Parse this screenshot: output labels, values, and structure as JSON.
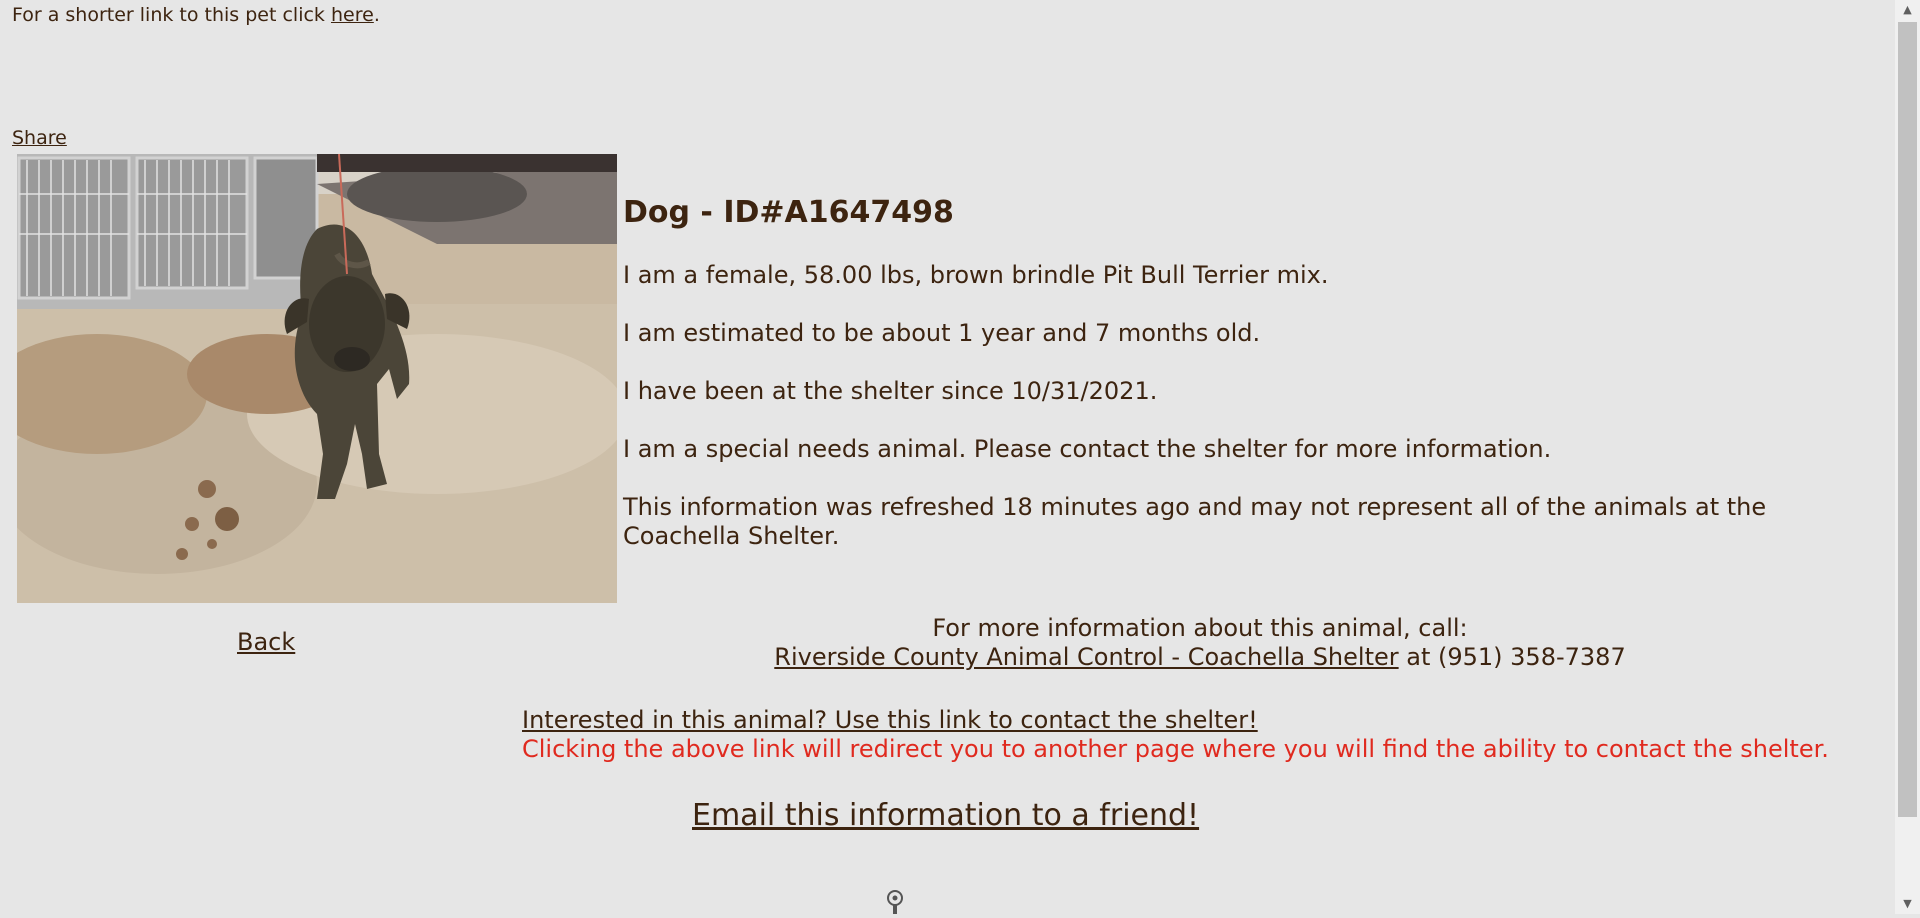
{
  "top": {
    "prefix": "For a shorter link to this pet click ",
    "link": "here",
    "suffix": "."
  },
  "share_label": "Share",
  "animal": {
    "heading": "Dog - ID#A1647498",
    "description": "I am a female, 58.00 lbs, brown brindle Pit Bull Terrier mix.",
    "age": "I am estimated to be about 1 year and 7 months old.",
    "since": "I have been at the shelter since 10/31/2021.",
    "special_needs": "I am a special needs animal. Please contact the shelter for more information.",
    "refresh": "This information was refreshed 18 minutes ago and may not represent all of the animals at the Coachella Shelter."
  },
  "back_label": "Back",
  "contact": {
    "intro": "For more information about this animal, call:",
    "shelter_link": "Riverside County Animal Control - Coachella Shelter",
    "phone_text": " at (951) 358-7387"
  },
  "interest": {
    "link": "Interested in this animal? Use this link to contact the shelter!",
    "note": "Clicking the above link will redirect you to another page where you will find the ability to contact the shelter."
  },
  "email_label": "Email this information to a friend!",
  "colors": {
    "background": "#e6e6e6",
    "text": "#3d2410",
    "warning": "#e02a1f"
  },
  "icons": {
    "photo": "dog-photo",
    "loading": "spinner-icon"
  }
}
